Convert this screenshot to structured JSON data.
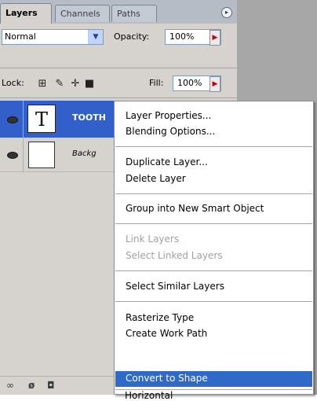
{
  "panel": {
    "tabs": [
      "Layers",
      "Channels",
      "Paths"
    ],
    "menu_icon": "panel-menu-icon",
    "blend_mode": "Normal",
    "opacity_label": "Opacity:",
    "opacity_value": "100%",
    "lock_label": "Lock:",
    "lock_icons": [
      "lock-transparent-pixels-icon",
      "lock-image-pixels-icon",
      "lock-position-icon",
      "lock-all-icon"
    ],
    "fill_label": "Fill:",
    "fill_value": "100%",
    "layers": [
      {
        "name": "TOOTH",
        "thumb_glyph": "T",
        "selected": true
      },
      {
        "name": "Backg",
        "thumb_glyph": "",
        "selected": false
      }
    ],
    "footer_icons": [
      "link-layers-icon",
      "add-layer-style-icon",
      "add-mask-icon"
    ]
  },
  "context_menu": {
    "items": [
      "Layer Properties...",
      "Blending Options...",
      "Duplicate Layer...",
      "Delete Layer",
      "Group into New Smart Object",
      "Link Layers",
      "Select Linked Layers",
      "Select Similar Layers",
      "Rasterize Type",
      "Create Work Path",
      "Convert to Shape",
      "Horizontal"
    ],
    "disabled": [
      "Link Layers",
      "Select Linked Layers"
    ],
    "highlighted": "Convert to Shape",
    "highlight_color": "#2f6ac9"
  },
  "colors": {
    "panel_bg": "#d6d3ce",
    "selected_layer": "#335fcb",
    "tab_bar": "#b6bcc6"
  }
}
